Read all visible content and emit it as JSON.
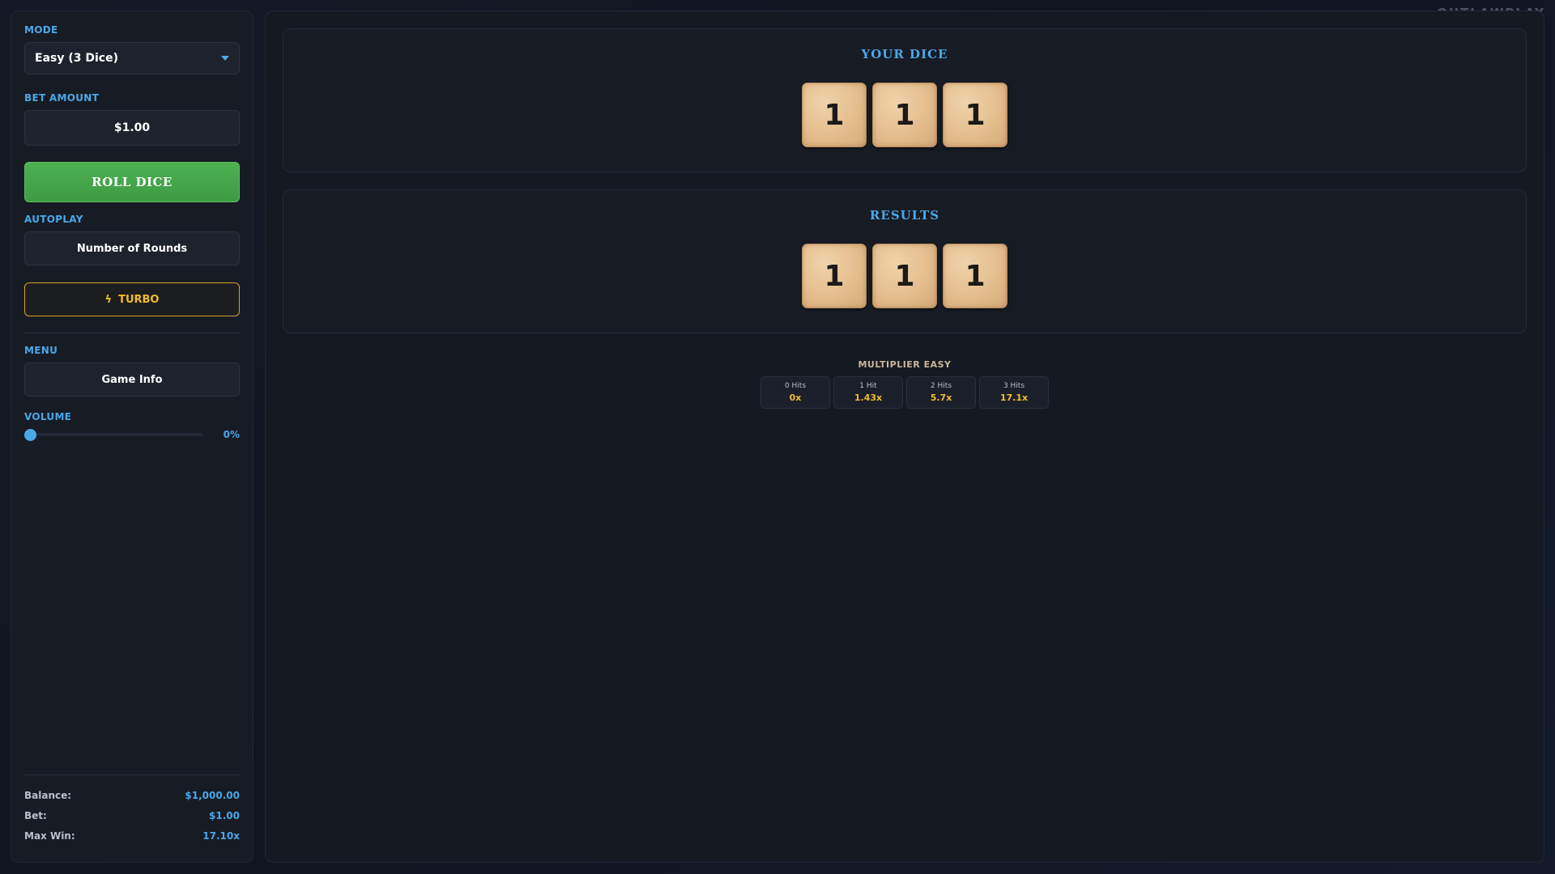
{
  "watermark": "OUTLAWPLAY",
  "sidebar": {
    "mode_label": "MODE",
    "mode_value": "Easy (3 Dice)",
    "bet_label": "BET AMOUNT",
    "bet_value": "$1.00",
    "roll_button": "ROLL DICE",
    "autoplay_label": "AUTOPLAY",
    "rounds_button": "Number of Rounds",
    "turbo_button": "TURBO",
    "menu_label": "MENU",
    "game_info_button": "Game Info",
    "volume_label": "VOLUME",
    "volume_value": "0%",
    "volume_level": 0
  },
  "stats": {
    "balance_label": "Balance:",
    "balance_value": "$1,000.00",
    "bet_label": "Bet:",
    "bet_value": "$1.00",
    "maxwin_label": "Max Win:",
    "maxwin_value": "17.10x"
  },
  "your_dice": {
    "title": "YOUR DICE",
    "values": [
      "1",
      "1",
      "1"
    ]
  },
  "results": {
    "title": "RESULTS",
    "values": [
      "1",
      "1",
      "1"
    ]
  },
  "multiplier": {
    "title": "MULTIPLIER EASY",
    "cells": [
      {
        "hits": "0 Hits",
        "value": "0x"
      },
      {
        "hits": "1 Hit",
        "value": "1.43x"
      },
      {
        "hits": "2 Hits",
        "value": "5.7x"
      },
      {
        "hits": "3 Hits",
        "value": "17.1x"
      }
    ]
  },
  "colors": {
    "accent": "#4aa8e8",
    "roll_green": "#47a84c",
    "turbo_gold": "#f0bb2e",
    "die_face": "#e3bb8b"
  }
}
